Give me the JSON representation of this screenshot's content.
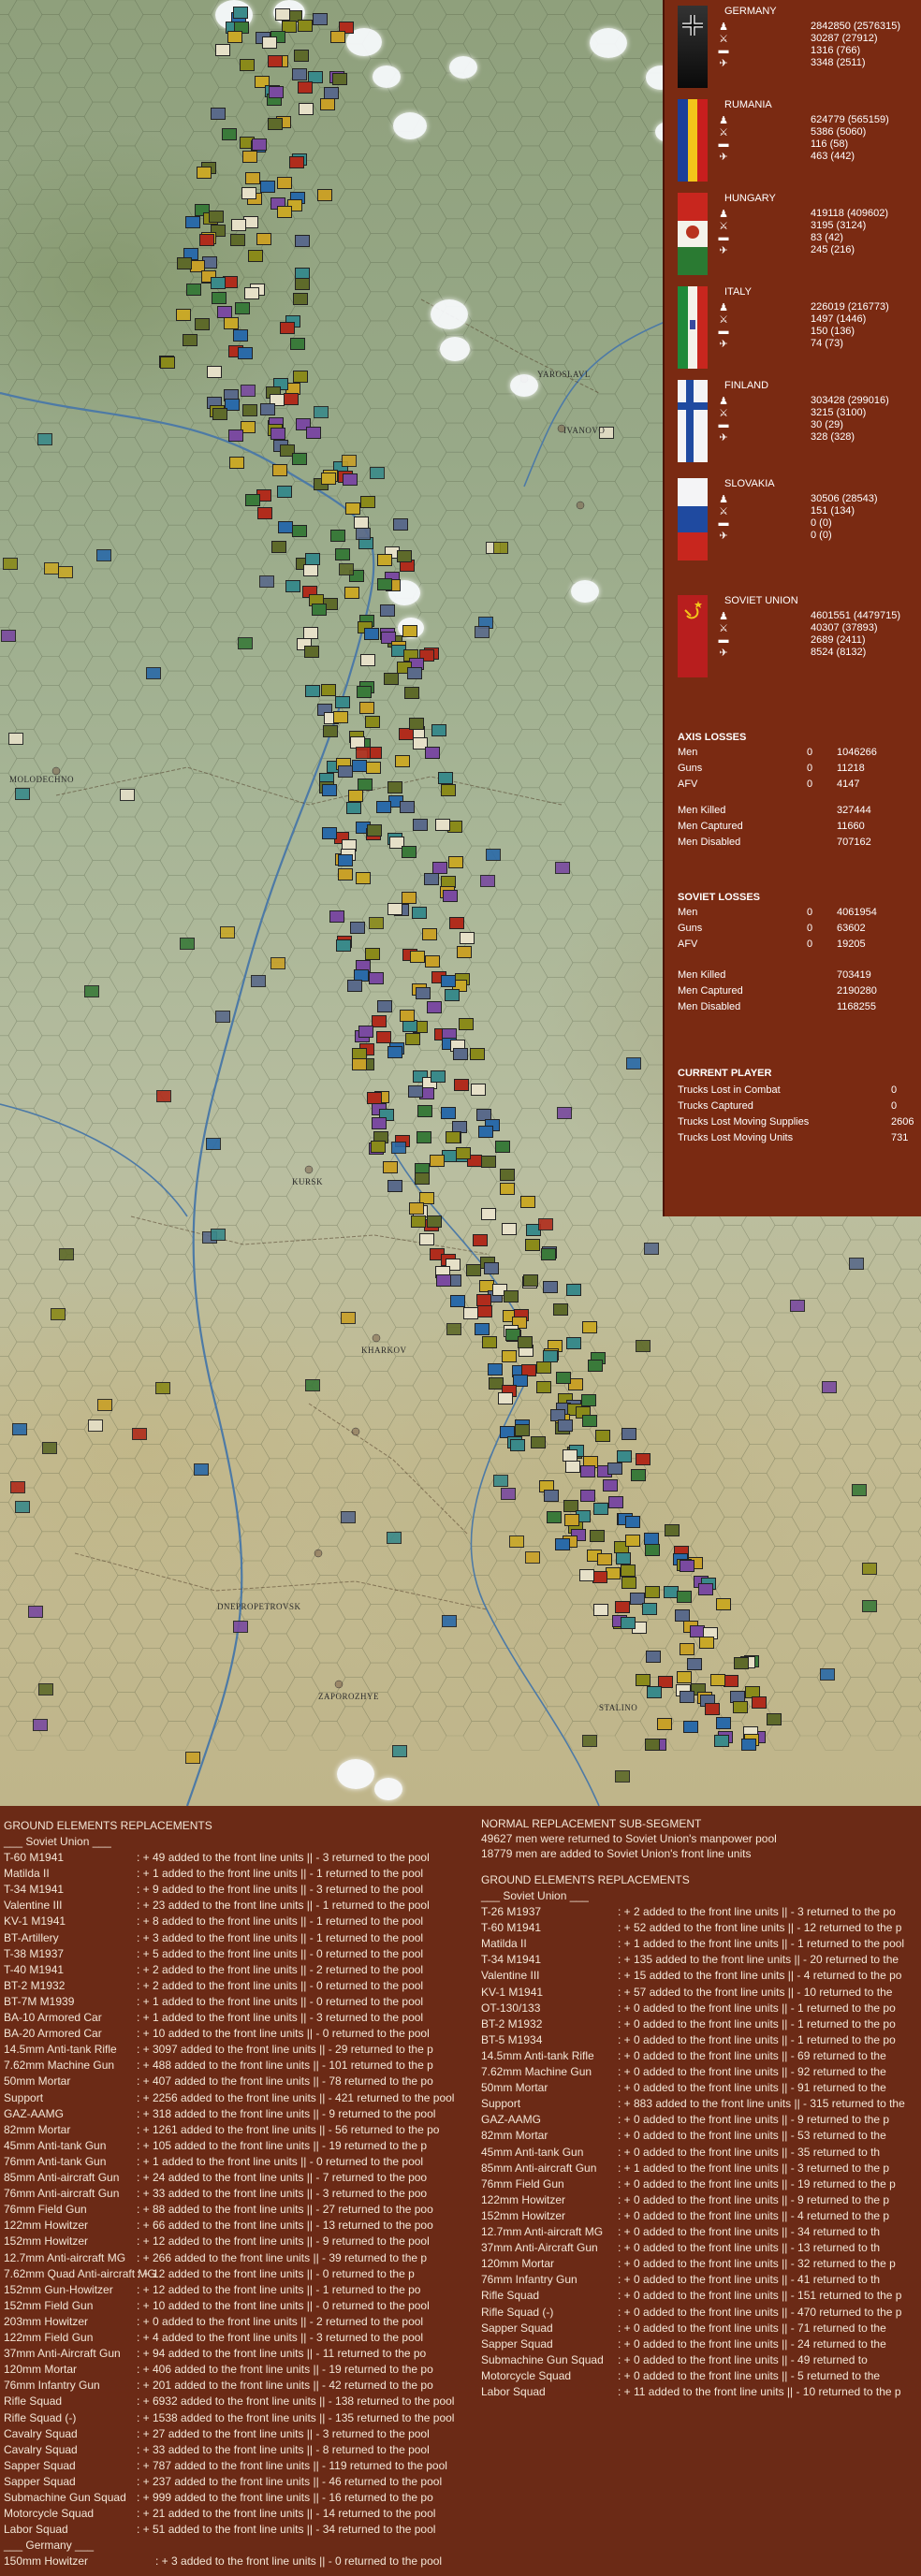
{
  "map": {
    "cities": [
      {
        "id": "yaroslavl",
        "label": "YAROSLAVL"
      },
      {
        "id": "ivanovo",
        "label": "IVANOVO"
      },
      {
        "id": "kursk",
        "label": "KURSK"
      },
      {
        "id": "kharkov",
        "label": "KHARKOV"
      },
      {
        "id": "dnepropetrovsk",
        "label": "DNEPROPETROVSK"
      },
      {
        "id": "zaporozhye",
        "label": "ZAPOROZHYE"
      },
      {
        "id": "stalino",
        "label": "STALINO"
      },
      {
        "id": "molodechno",
        "label": "MOLODECHNO"
      }
    ],
    "colors": {
      "german": "#5a6a8a",
      "soviet_olive": "#8a8a1a",
      "soviet_red": "#b02c1c",
      "hungary": "#5e6a2a",
      "rumania": "#c8a828",
      "finland": "#2a6aa8",
      "italy": "#3a7a3a"
    }
  },
  "panel": {
    "nations": [
      {
        "name": "GERMANY",
        "flag": "germany",
        "men": "2842850 (2576315)",
        "guns": "30287 (27912)",
        "afv": "1316 (766)",
        "air": "3348 (2511)"
      },
      {
        "name": "RUMANIA",
        "flag": "rumania",
        "men": "624779 (565159)",
        "guns": "5386 (5060)",
        "afv": "116 (58)",
        "air": "463 (442)"
      },
      {
        "name": "HUNGARY",
        "flag": "hungary",
        "men": "419118 (409602)",
        "guns": "3195 (3124)",
        "afv": "83 (42)",
        "air": "245 (216)"
      },
      {
        "name": "ITALY",
        "flag": "italy",
        "men": "226019 (216773)",
        "guns": "1497 (1446)",
        "afv": "150 (136)",
        "air": "74 (73)"
      },
      {
        "name": "FINLAND",
        "flag": "finland",
        "men": "303428 (299016)",
        "guns": "3215 (3100)",
        "afv": "30 (29)",
        "air": "328 (328)"
      },
      {
        "name": "SLOVAKIA",
        "flag": "slovakia",
        "men": "30506 (28543)",
        "guns": "151 (134)",
        "afv": "0 (0)",
        "air": "0 (0)"
      },
      {
        "name": "SOVIET UNION",
        "flag": "soviet",
        "men": "4601551 (4479715)",
        "guns": "40307 (37893)",
        "afv": "2689 (2411)",
        "air": "8524 (8132)"
      }
    ],
    "axis_losses": {
      "title": "AXIS LOSSES",
      "rows": [
        {
          "label": "Men",
          "zero": "0",
          "value": "1046266"
        },
        {
          "label": "Guns",
          "zero": "0",
          "value": "11218"
        },
        {
          "label": "AFV",
          "zero": "0",
          "value": "4147"
        }
      ],
      "rows2": [
        {
          "label": "Men Killed",
          "value": "327444"
        },
        {
          "label": "Men Captured",
          "value": "11660"
        },
        {
          "label": "Men Disabled",
          "value": "707162"
        }
      ]
    },
    "soviet_losses": {
      "title": "SOVIET LOSSES",
      "rows": [
        {
          "label": "Men",
          "zero": "0",
          "value": "4061954"
        },
        {
          "label": "Guns",
          "zero": "0",
          "value": "63602"
        },
        {
          "label": "AFV",
          "zero": "0",
          "value": "19205"
        }
      ],
      "rows2": [
        {
          "label": "Men Killed",
          "value": "703419"
        },
        {
          "label": "Men Captured",
          "value": "2190280"
        },
        {
          "label": "Men Disabled",
          "value": "1168255"
        }
      ]
    },
    "current_player": {
      "title": "CURRENT PLAYER",
      "rows": [
        {
          "label": "Trucks Lost in Combat",
          "value": "0"
        },
        {
          "label": "Trucks Captured",
          "value": "0"
        },
        {
          "label": "Trucks Lost Moving Supplies",
          "value": "2606"
        },
        {
          "label": "Trucks Lost Moving Units",
          "value": "731"
        }
      ]
    }
  },
  "log": {
    "left": {
      "title": "GROUND ELEMENTS REPLACEMENTS",
      "side": "___ Soviet Union ___",
      "entries": [
        [
          "T-60 M1941",
          ": + 49 added to the front line units || - 3 returned to the pool"
        ],
        [
          "Matilda II",
          ": + 1 added to the front line units || - 1 returned to the pool"
        ],
        [
          "T-34 M1941",
          ": + 9 added to the front line units || - 3 returned to the pool"
        ],
        [
          "Valentine III",
          ": + 23 added to the front line units || - 1 returned to the pool"
        ],
        [
          "KV-1 M1941",
          ": + 8 added to the front line units || - 1 returned to the pool"
        ],
        [
          "BT-Artillery",
          ": + 3 added to the front line units || - 1 returned to the pool"
        ],
        [
          "T-38 M1937",
          ": + 5 added to the front line units || - 0 returned to the pool"
        ],
        [
          "T-40 M1941",
          ": + 2 added to the front line units || - 2 returned to the pool"
        ],
        [
          "BT-2 M1932",
          ": + 2 added to the front line units || - 0 returned to the pool"
        ],
        [
          "BT-7M M1939",
          ": + 1 added to the front line units || - 0 returned to the pool"
        ],
        [
          "BA-10 Armored Car",
          ": + 1 added to the front line units || - 3 returned to the pool"
        ],
        [
          "BA-20 Armored Car",
          ": + 10 added to the front line units || - 0 returned to the pool"
        ],
        [
          "14.5mm Anti-tank Rifle",
          ": + 3097 added to the front line units || - 29 returned to the p"
        ],
        [
          "7.62mm Machine Gun",
          ": + 488 added to the front line units || - 101 returned to the p"
        ],
        [
          "50mm Mortar",
          ": + 407 added to the front line units || - 78 returned to the po"
        ],
        [
          "Support",
          ": + 2256 added to the front line units || - 421 returned to the pool"
        ],
        [
          "GAZ-AAMG",
          ": + 318 added to the front line units || - 9 returned to the pool"
        ],
        [
          "82mm Mortar",
          ": + 1261 added to the front line units || - 56 returned to the po"
        ],
        [
          "45mm Anti-tank Gun",
          ": + 105 added to the front line units || - 19 returned to the p"
        ],
        [
          "76mm Anti-tank Gun",
          ": + 1 added to the front line units || - 0 returned to the pool"
        ],
        [
          "85mm Anti-aircraft Gun",
          ": + 24 added to the front line units || - 7 returned to the poo"
        ],
        [
          "76mm Anti-aircraft Gun",
          ": + 33 added to the front line units || - 3 returned to the poo"
        ],
        [
          "76mm Field Gun",
          ": + 88 added to the front line units || - 27 returned to the poo"
        ],
        [
          "122mm Howitzer",
          ": + 66 added to the front line units || - 13 returned to the poo"
        ],
        [
          "152mm Howitzer",
          ": + 12 added to the front line units || - 9 returned to the pool"
        ],
        [
          "12.7mm Anti-aircraft MG",
          ": + 266 added to the front line units || - 39 returned to the p"
        ],
        [
          "7.62mm Quad Anti-aircraft MG",
          ": + 12 added to the front line units || - 0 returned to the p"
        ],
        [
          "152mm Gun-Howitzer",
          ": + 12 added to the front line units || - 1 returned to the po"
        ],
        [
          "152mm Field Gun",
          ": + 10 added to the front line units || - 0 returned to the pool"
        ],
        [
          "203mm Howitzer",
          ": + 0 added to the front line units || - 2 returned to the pool"
        ],
        [
          "122mm Field Gun",
          ": + 4 added to the front line units || - 3 returned to the pool"
        ],
        [
          "37mm Anti-Aircraft Gun",
          ": + 94 added to the front line units || - 11 returned to the po"
        ],
        [
          "120mm Mortar",
          ": + 406 added to the front line units || - 19 returned to the po"
        ],
        [
          "76mm Infantry Gun",
          ": + 201 added to the front line units || - 42 returned to the po"
        ],
        [
          "Rifle Squad",
          ": + 6932 added to the front line units || - 138 returned to the pool"
        ],
        [
          "Rifle Squad (-)",
          ": + 1538 added to the front line units || - 135 returned to the pool"
        ],
        [
          "Cavalry Squad",
          ": + 27 added to the front line units || - 3 returned to the pool"
        ],
        [
          "Cavalry Squad",
          ": + 33 added to the front line units || - 8 returned to the pool"
        ],
        [
          "Sapper Squad",
          ": + 787 added to the front line units || - 119 returned to the pool"
        ],
        [
          "Sapper Squad",
          ": + 237 added to the front line units || - 46 returned to the pool"
        ],
        [
          "Submachine Gun Squad",
          ": + 999 added to the front line units || - 16 returned to the po"
        ],
        [
          "Motorcycle Squad",
          ": + 21 added to the front line units || - 14 returned to the pool"
        ],
        [
          "Labor Squad",
          ": + 51 added to the front line units || - 34 returned to the pool"
        ]
      ],
      "side2": "___ Germany ___",
      "entries2": [
        [
          "150mm Howitzer",
          ": + 3 added to the front line units || - 0 returned to the pool"
        ]
      ]
    },
    "right": {
      "title": "NORMAL REPLACEMENT SUB-SEGMENT",
      "lines": [
        "49627 men were returned to Soviet Union's manpower pool",
        "18779 men are added to Soviet Union's front line units"
      ],
      "title2": "GROUND ELEMENTS REPLACEMENTS",
      "side": "___ Soviet Union ___",
      "entries": [
        [
          "T-26 M1937",
          ": + 2 added to the front line units || - 3 returned to the po"
        ],
        [
          "T-60 M1941",
          ": + 52 added to the front line units || - 12 returned to the p"
        ],
        [
          "Matilda II",
          ": + 1 added to the front line units || - 1 returned to the pool"
        ],
        [
          "T-34 M1941",
          ": + 135 added to the front line units || - 20 returned to the"
        ],
        [
          "Valentine III",
          ": + 15 added to the front line units || - 4 returned to the po"
        ],
        [
          "KV-1 M1941",
          ": + 57 added to the front line units || - 10 returned to the"
        ],
        [
          "OT-130/133",
          ": + 0 added to the front line units || - 1 returned to the po"
        ],
        [
          "BT-2 M1932",
          ": + 0 added to the front line units || - 1 returned to the po"
        ],
        [
          "BT-5 M1934",
          ": + 0 added to the front line units || - 1 returned to the po"
        ],
        [
          "14.5mm Anti-tank Rifle",
          ": + 0 added to the front line units || - 69 returned to the"
        ],
        [
          "7.62mm Machine Gun",
          ": + 0 added to the front line units || - 92 returned to the"
        ],
        [
          "50mm Mortar",
          ": + 0 added to the front line units || - 91 returned to the"
        ],
        [
          "Support",
          ": + 883 added to the front line units || - 315 returned to the"
        ],
        [
          "GAZ-AAMG",
          ": + 0 added to the front line units || - 9 returned to the p"
        ],
        [
          "82mm Mortar",
          ": + 0 added to the front line units || - 53 returned to the"
        ],
        [
          "45mm Anti-tank Gun",
          ": + 0 added to the front line units || - 35 returned to th"
        ],
        [
          "85mm Anti-aircraft Gun",
          ": + 1 added to the front line units || - 3 returned to the p"
        ],
        [
          "76mm Field Gun",
          ": + 0 added to the front line units || - 19 returned to the p"
        ],
        [
          "122mm Howitzer",
          ": + 0 added to the front line units || - 9 returned to the p"
        ],
        [
          "152mm Howitzer",
          ": + 0 added to the front line units || - 4 returned to the p"
        ],
        [
          "12.7mm Anti-aircraft MG",
          ": + 0 added to the front line units || - 34 returned to th"
        ],
        [
          "37mm Anti-Aircraft Gun",
          ": + 0 added to the front line units || - 13 returned to th"
        ],
        [
          "120mm Mortar",
          ": + 0 added to the front line units || - 32 returned to the p"
        ],
        [
          "76mm Infantry Gun",
          ": + 0 added to the front line units || - 41 returned to th"
        ],
        [
          "Rifle Squad",
          ": + 0 added to the front line units || - 151 returned to the p"
        ],
        [
          "Rifle Squad (-)",
          ": + 0 added to the front line units || - 470 returned to the p"
        ],
        [
          "Sapper Squad",
          ": + 0 added to the front line units || - 71 returned to the"
        ],
        [
          "Sapper Squad",
          ": + 0 added to the front line units || - 24 returned to the"
        ],
        [
          "Submachine Gun Squad",
          ": + 0 added to the front line units || - 49 returned to"
        ],
        [
          "Motorcycle Squad",
          ": + 0 added to the front line units || - 5 returned to the"
        ],
        [
          "Labor Squad",
          ": + 11 added to the front line units || - 10 returned to the p"
        ]
      ]
    }
  }
}
